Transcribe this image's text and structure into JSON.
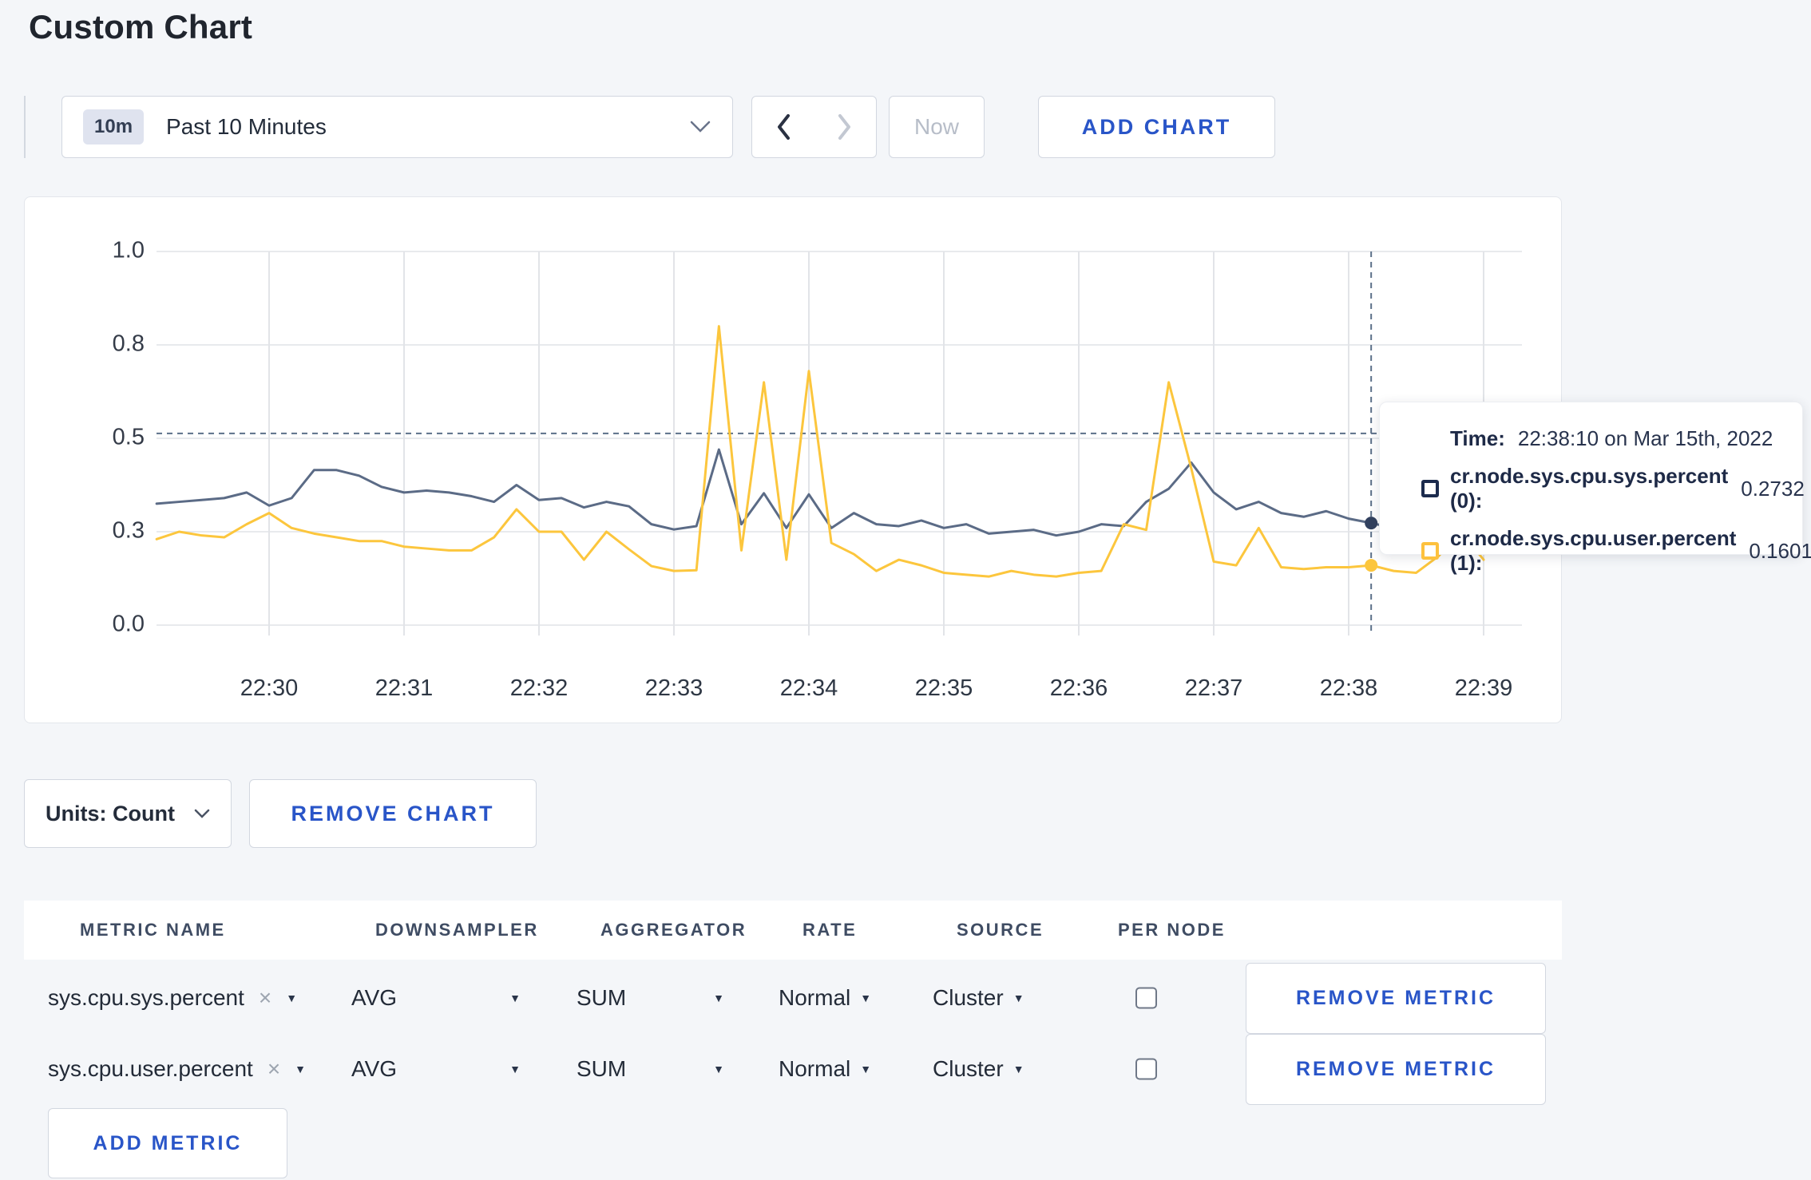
{
  "page": {
    "title": "Custom Chart"
  },
  "icons": {
    "caret_down": "▼",
    "close": "×"
  },
  "toolbar": {
    "time_range_badge": "10m",
    "time_range_label": "Past 10 Minutes",
    "now_label": "Now",
    "add_chart_label": "ADD CHART"
  },
  "chart_data": {
    "type": "line",
    "title": "",
    "xlabel": "",
    "ylabel": "",
    "ylim": [
      0,
      1
    ],
    "grid": true,
    "legend_position": "tooltip",
    "x_ticks": [
      "22:30",
      "22:31",
      "22:32",
      "22:33",
      "22:34",
      "22:35",
      "22:36",
      "22:37",
      "22:38",
      "22:39"
    ],
    "y_ticks": [
      {
        "v": 0.0,
        "label": "0.0"
      },
      {
        "v": 0.25,
        "label": "0.3"
      },
      {
        "v": 0.5,
        "label": "0.5"
      },
      {
        "v": 0.75,
        "label": "0.8"
      },
      {
        "v": 1.0,
        "label": "1.0"
      }
    ],
    "x_start_offset_seconds": -50,
    "step_seconds": 10,
    "series": [
      {
        "name": "cr.node.sys.cpu.sys.percent",
        "color": "#5b6b86",
        "values": [
          0.325,
          0.33,
          0.335,
          0.34,
          0.355,
          0.32,
          0.34,
          0.415,
          0.415,
          0.4,
          0.37,
          0.355,
          0.36,
          0.355,
          0.345,
          0.33,
          0.375,
          0.335,
          0.34,
          0.315,
          0.33,
          0.318,
          0.27,
          0.256,
          0.265,
          0.47,
          0.27,
          0.353,
          0.26,
          0.35,
          0.26,
          0.3,
          0.27,
          0.265,
          0.28,
          0.26,
          0.27,
          0.245,
          0.25,
          0.255,
          0.24,
          0.25,
          0.27,
          0.265,
          0.33,
          0.365,
          0.435,
          0.355,
          0.31,
          0.33,
          0.3,
          0.29,
          0.305,
          0.285,
          0.2732,
          0.26,
          0.27,
          0.28,
          0.29,
          0.3
        ]
      },
      {
        "name": "cr.node.sys.cpu.user.percent",
        "color": "#fcc63d",
        "values": [
          0.23,
          0.25,
          0.24,
          0.235,
          0.27,
          0.3,
          0.26,
          0.245,
          0.235,
          0.225,
          0.225,
          0.21,
          0.205,
          0.2,
          0.2,
          0.235,
          0.31,
          0.25,
          0.25,
          0.175,
          0.25,
          0.203,
          0.158,
          0.145,
          0.147,
          0.8,
          0.2,
          0.65,
          0.175,
          0.68,
          0.22,
          0.19,
          0.145,
          0.175,
          0.16,
          0.14,
          0.135,
          0.13,
          0.145,
          0.135,
          0.13,
          0.14,
          0.145,
          0.27,
          0.255,
          0.65,
          0.42,
          0.17,
          0.16,
          0.26,
          0.155,
          0.15,
          0.155,
          0.155,
          0.1601,
          0.145,
          0.14,
          0.185,
          0.25,
          0.175
        ]
      }
    ],
    "crosshair": {
      "offset_seconds": 490,
      "h_value": 0.513,
      "dot_values": [
        0.2732,
        0.1601
      ]
    }
  },
  "tooltip": {
    "time_label": "Time:",
    "time_value": "22:38:10 on Mar 15th, 2022",
    "rows": [
      {
        "label": "cr.node.sys.cpu.sys.percent (0):",
        "value": "0.2732",
        "color": "#1c2b4d"
      },
      {
        "label": "cr.node.sys.cpu.user.percent (1):",
        "value": "0.1601",
        "color": "#fdc13e"
      }
    ]
  },
  "chart_footer": {
    "units_label": "Units: Count",
    "remove_chart_label": "REMOVE CHART"
  },
  "metrics_table": {
    "headers": [
      "METRIC NAME",
      "DOWNSAMPLER",
      "AGGREGATOR",
      "RATE",
      "SOURCE",
      "PER NODE"
    ],
    "header_x": [
      70,
      440,
      722,
      975,
      1168,
      1370
    ],
    "rows": [
      {
        "metric": "sys.cpu.sys.percent",
        "downsampler": "AVG",
        "aggregator": "SUM",
        "rate": "Normal",
        "source": "Cluster",
        "per_node": false,
        "remove_label": "REMOVE METRIC"
      },
      {
        "metric": "sys.cpu.user.percent",
        "downsampler": "AVG",
        "aggregator": "SUM",
        "rate": "Normal",
        "source": "Cluster",
        "per_node": false,
        "remove_label": "REMOVE METRIC"
      }
    ],
    "add_metric_label": "ADD METRIC"
  }
}
